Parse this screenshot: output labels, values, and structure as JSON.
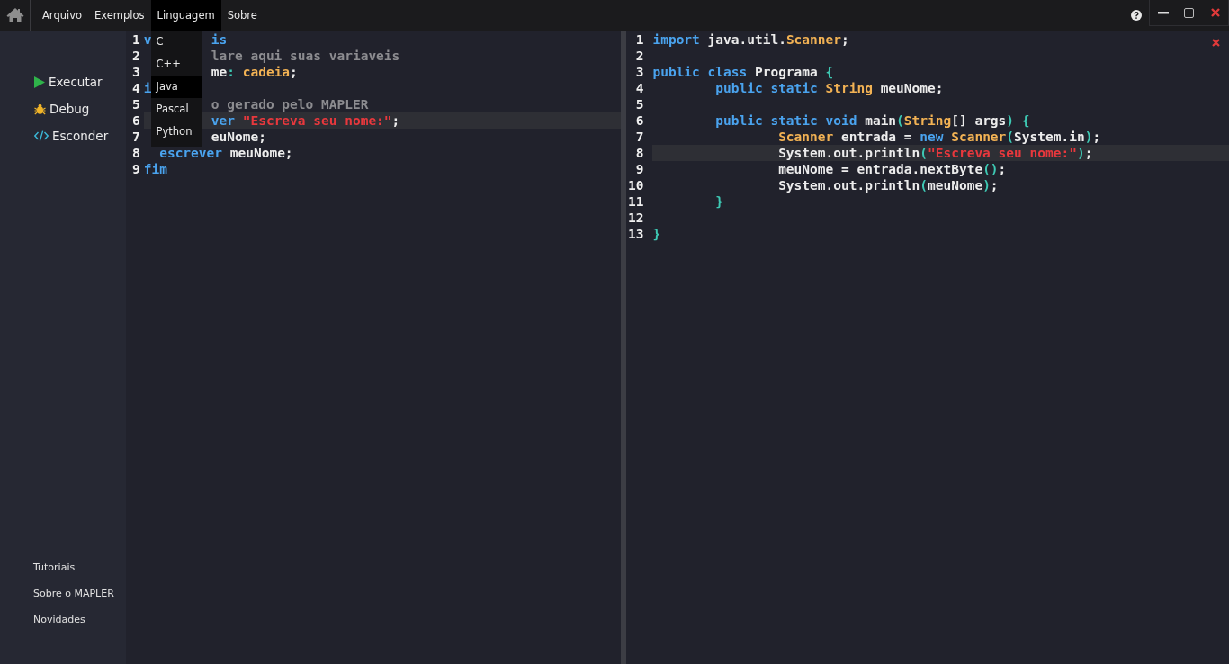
{
  "menubar": {
    "items": [
      {
        "label": "Arquivo",
        "selected": false
      },
      {
        "label": "Exemplos",
        "selected": false
      },
      {
        "label": "Linguagem",
        "selected": true
      },
      {
        "label": "Sobre",
        "selected": false
      }
    ]
  },
  "dropdown": {
    "items": [
      {
        "label": "C",
        "selected": false
      },
      {
        "label": "C++",
        "selected": false
      },
      {
        "label": "Java",
        "selected": true
      },
      {
        "label": "Pascal",
        "selected": false
      },
      {
        "label": "Python",
        "selected": false
      }
    ]
  },
  "sidebar": {
    "actions": [
      {
        "kind": "run",
        "label": "Executar"
      },
      {
        "kind": "debug",
        "label": "Debug"
      },
      {
        "kind": "hide",
        "label": "Esconder"
      }
    ],
    "links": [
      "Tutoriais",
      "Sobre o MAPLER",
      "Novidades"
    ]
  },
  "source_editor": {
    "lines": [
      {
        "number": "1",
        "current": false,
        "before": [
          {
            "kind": "kw",
            "text": "v"
          }
        ],
        "after": [
          {
            "kind": "kw",
            "text": "is"
          }
        ]
      },
      {
        "number": "2",
        "current": false,
        "after": [
          {
            "kind": "comment",
            "text": "lare aqui suas variaveis"
          }
        ]
      },
      {
        "number": "3",
        "current": false,
        "after": [
          {
            "kind": "plain",
            "text": "me"
          },
          {
            "kind": "op",
            "text": ":"
          },
          {
            "kind": "type",
            "text": " cadeia"
          },
          {
            "kind": "plain",
            "text": ";"
          }
        ]
      },
      {
        "number": "4",
        "current": false,
        "before": [
          {
            "kind": "kw",
            "text": "i"
          }
        ]
      },
      {
        "number": "5",
        "current": false,
        "after": [
          {
            "kind": "comment",
            "text": "o gerado pelo MAPLER"
          }
        ]
      },
      {
        "number": "6",
        "current": true,
        "after": [
          {
            "kind": "kw",
            "text": "ver"
          },
          {
            "kind": "str",
            "text": " \"Escreva seu nome:\""
          },
          {
            "kind": "plain",
            "text": ";"
          }
        ]
      },
      {
        "number": "7",
        "current": false,
        "after": [
          {
            "kind": "plain",
            "text": "euNome;"
          }
        ]
      },
      {
        "number": "8",
        "current": false,
        "before": [
          {
            "kind": "kw",
            "text": "  escrever"
          },
          {
            "kind": "plain",
            "text": " meuNome;"
          }
        ]
      },
      {
        "number": "9",
        "current": false,
        "before": [
          {
            "kind": "kw",
            "text": "fim"
          }
        ]
      }
    ]
  },
  "output_editor": {
    "lines": [
      {
        "number": "1",
        "current": false,
        "tokens": [
          {
            "kind": "kw",
            "text": "import"
          },
          {
            "kind": "plain",
            "text": " java.util."
          },
          {
            "kind": "type",
            "text": "Scanner"
          },
          {
            "kind": "plain",
            "text": ";"
          }
        ]
      },
      {
        "number": "2",
        "current": false
      },
      {
        "number": "3",
        "current": false,
        "tokens": [
          {
            "kind": "kw",
            "text": "public class"
          },
          {
            "kind": "plain",
            "text": " Programa"
          },
          {
            "kind": "op",
            "text": " {"
          }
        ]
      },
      {
        "number": "4",
        "current": false,
        "tokens": [
          {
            "kind": "kw",
            "text": "\tpublic static"
          },
          {
            "kind": "type",
            "text": " String"
          },
          {
            "kind": "plain",
            "text": " meuNome;"
          }
        ]
      },
      {
        "number": "5",
        "current": false
      },
      {
        "number": "6",
        "current": false,
        "tokens": [
          {
            "kind": "kw",
            "text": "\tpublic static void"
          },
          {
            "kind": "plain",
            "text": " main"
          },
          {
            "kind": "op",
            "text": "("
          },
          {
            "kind": "type",
            "text": "String"
          },
          {
            "kind": "plain",
            "text": "[] args"
          },
          {
            "kind": "op",
            "text": ") {"
          }
        ]
      },
      {
        "number": "7",
        "current": false,
        "tokens": [
          {
            "kind": "type",
            "text": "\t\tScanner"
          },
          {
            "kind": "plain",
            "text": " entrada ="
          },
          {
            "kind": "kw",
            "text": " new"
          },
          {
            "kind": "type",
            "text": " Scanner"
          },
          {
            "kind": "op",
            "text": "("
          },
          {
            "kind": "plain",
            "text": "System.in"
          },
          {
            "kind": "op",
            "text": ")"
          },
          {
            "kind": "plain",
            "text": ";"
          }
        ]
      },
      {
        "number": "8",
        "current": true,
        "tokens": [
          {
            "kind": "plain",
            "text": "\t\tSystem.out.println"
          },
          {
            "kind": "op",
            "text": "("
          },
          {
            "kind": "str",
            "text": "\"Escreva seu nome:\""
          },
          {
            "kind": "op",
            "text": ")"
          },
          {
            "kind": "plain",
            "text": ";"
          }
        ]
      },
      {
        "number": "9",
        "current": false,
        "tokens": [
          {
            "kind": "plain",
            "text": "\t\tmeuNome = entrada.nextByte"
          },
          {
            "kind": "op",
            "text": "()"
          },
          {
            "kind": "plain",
            "text": ";"
          }
        ]
      },
      {
        "number": "10",
        "current": false,
        "tokens": [
          {
            "kind": "plain",
            "text": "\t\tSystem.out.println"
          },
          {
            "kind": "op",
            "text": "("
          },
          {
            "kind": "plain",
            "text": "meuNome"
          },
          {
            "kind": "op",
            "text": ")"
          },
          {
            "kind": "plain",
            "text": ";"
          }
        ]
      },
      {
        "number": "11",
        "current": false,
        "tokens": [
          {
            "kind": "op",
            "text": "\t}"
          }
        ]
      },
      {
        "number": "12",
        "current": false
      },
      {
        "number": "13",
        "current": false,
        "tokens": [
          {
            "kind": "op",
            "text": "}"
          }
        ]
      }
    ]
  }
}
